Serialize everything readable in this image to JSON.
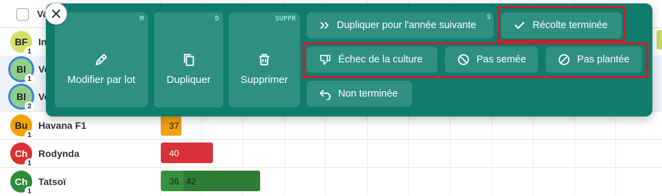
{
  "table": {
    "header_label": "Va",
    "rows": [
      {
        "initials": "BF",
        "count": "1",
        "name": "In",
        "color": "#d4e06a"
      },
      {
        "initials": "Bl",
        "count": "1",
        "name": "Ve",
        "color": "#8fd08a"
      },
      {
        "initials": "Bl",
        "count": "2",
        "name": "Ve",
        "color": "#8fd08a"
      },
      {
        "initials": "Bu",
        "count": "1",
        "name": "Havana F1",
        "color": "#f5a20a",
        "bar_value": "37",
        "bar_color": "#f0a010"
      },
      {
        "initials": "Ch",
        "count": "1",
        "name": "Rodynda",
        "color": "#d93030",
        "bar_value": "40",
        "bar_color": "#d9303a"
      },
      {
        "initials": "Ch",
        "count": "1",
        "name": "Tatsoï",
        "color": "#2e8b3a",
        "bar_value": "36",
        "bar_value2": "42",
        "bar_color": "#35913c"
      }
    ]
  },
  "actions": {
    "bulk_edit": {
      "label": "Modifier par lot",
      "shortcut": "M",
      "icon": "pencil-icon"
    },
    "duplicate": {
      "label": "Dupliquer",
      "shortcut": "D",
      "icon": "copy-icon"
    },
    "delete": {
      "label": "Supprimer",
      "shortcut": "SUPPR",
      "icon": "trash-icon"
    },
    "duplicate_next_year": {
      "label": "Dupliquer pour l'année suivante",
      "shortcut": "S",
      "icon": "double-chevron-right-icon"
    },
    "harvest_done": {
      "label": "Récolte terminée",
      "icon": "check-icon"
    },
    "crop_failure": {
      "label": "Échec de la culture",
      "icon": "thumbs-down-icon"
    },
    "not_sown": {
      "label": "Pas semée",
      "icon": "prohibited-icon"
    },
    "not_planted": {
      "label": "Pas plantée",
      "icon": "slash-circle-icon"
    },
    "not_finished": {
      "label": "Non terminée",
      "icon": "undo-icon"
    }
  },
  "colors": {
    "panel": "#0f7c6c",
    "button": "#2f9080",
    "highlight": "#d21a2a",
    "selection_ring": "#3f7fd9"
  }
}
